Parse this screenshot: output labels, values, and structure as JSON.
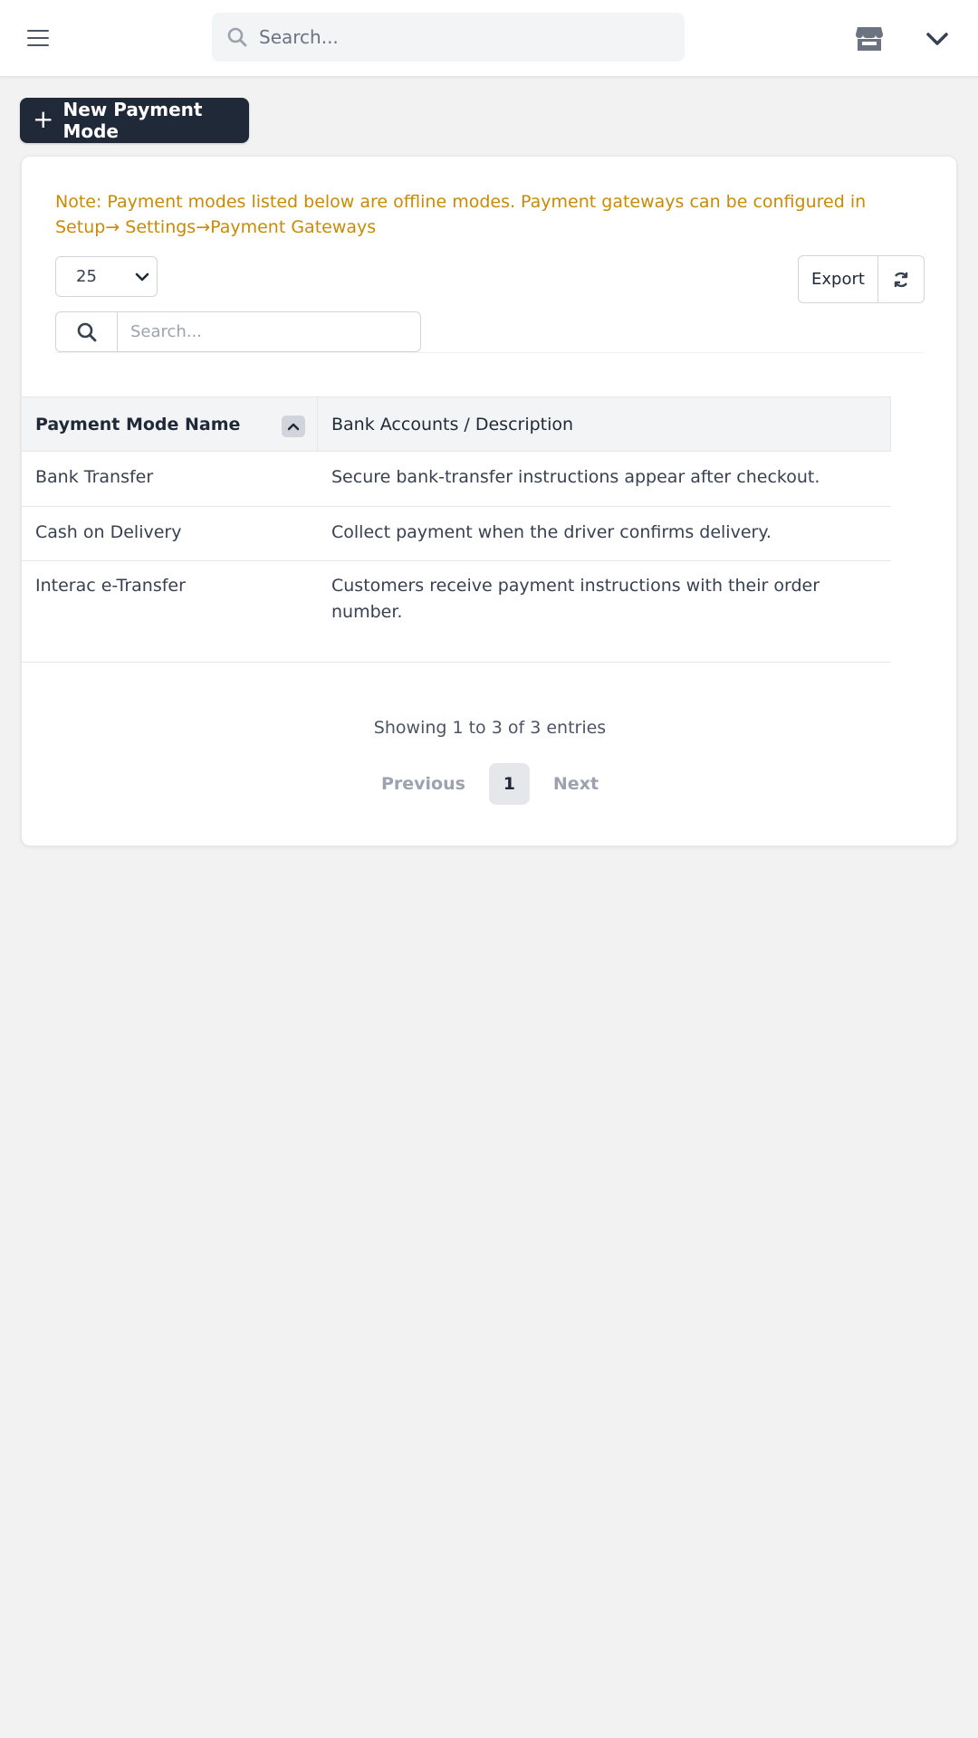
{
  "topbar": {
    "search_placeholder": "Search...",
    "icons": [
      "menu-icon",
      "search-icon",
      "store-icon",
      "chevron-down-icon"
    ]
  },
  "actions": {
    "new_label": "New Payment Mode"
  },
  "note": {
    "line1": "Note: Payment modes listed below are offline modes. Payment gateways can be configured in",
    "line2": "Setup→ Settings→Payment Gateways"
  },
  "table_controls": {
    "page_size": "25",
    "export_label": "Export",
    "search_placeholder": "Search..."
  },
  "table": {
    "columns": [
      "Payment Mode Name",
      "Bank Accounts / Description"
    ],
    "rows": [
      [
        "Bank Transfer",
        "Secure bank-transfer instructions appear after checkout."
      ],
      [
        "Cash on Delivery",
        "Collect payment when the driver confirms delivery."
      ],
      [
        "Interac e-Transfer",
        "Customers receive payment instructions with their order number."
      ]
    ]
  },
  "pagination": {
    "info": "Showing 1 to 3 of 3 entries",
    "previous": "Previous",
    "current": "1",
    "next": "Next"
  },
  "colors": {
    "primary_button": "#1f2937",
    "note_text": "#ca8a04",
    "background": "#f2f2f3"
  }
}
